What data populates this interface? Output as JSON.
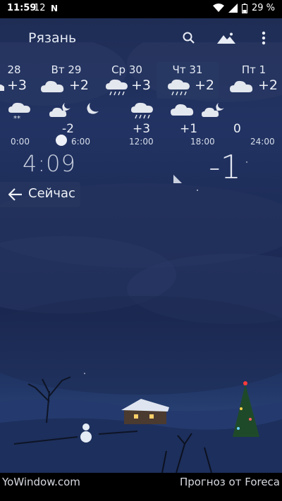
{
  "status": {
    "time": "11:59",
    "notif1": "12",
    "battery": "29 %"
  },
  "header": {
    "city": "Рязань"
  },
  "days": [
    {
      "name": "28",
      "temp": "+3"
    },
    {
      "name": "Вт 29",
      "temp": "+2"
    },
    {
      "name": "Ср 30",
      "temp": "+3"
    },
    {
      "name": "Чт 31",
      "temp": "+2"
    },
    {
      "name": "Пт 1",
      "temp": "+2"
    }
  ],
  "hourly": {
    "temps": [
      "-2",
      "+3",
      "+1",
      "0"
    ],
    "ticks": [
      "0:00",
      "6:00",
      "12:00",
      "18:00",
      "24:00"
    ]
  },
  "current": {
    "time": "4:09",
    "temp": "-1",
    "now_label": "Сейчас"
  },
  "footer": {
    "brand": "YoWindow.com",
    "source": "Прогноз от Foreca"
  }
}
